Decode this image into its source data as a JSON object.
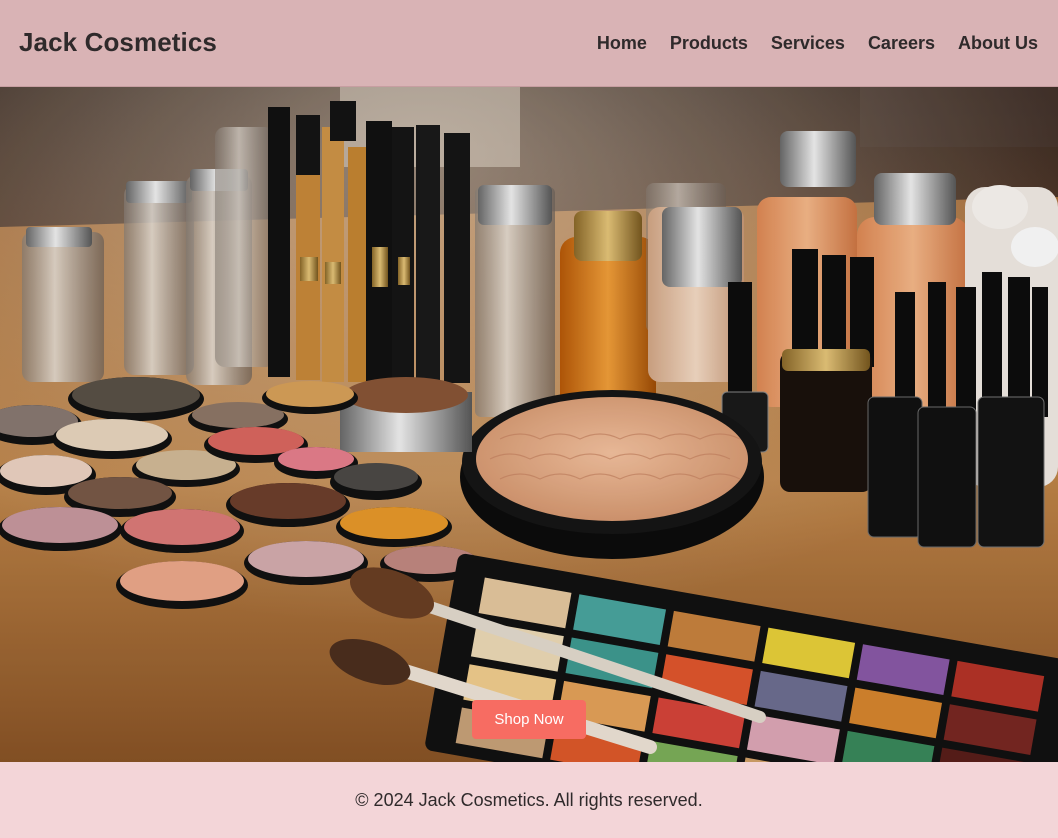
{
  "header": {
    "brand": "Jack Cosmetics",
    "nav": [
      {
        "label": "Home"
      },
      {
        "label": "Products"
      },
      {
        "label": "Services"
      },
      {
        "label": "Careers"
      },
      {
        "label": "About Us"
      }
    ]
  },
  "hero": {
    "cta_label": "Shop Now"
  },
  "footer": {
    "copyright": "© 2024 Jack Cosmetics. All rights reserved."
  },
  "colors": {
    "header_bg": "#d9b3b5",
    "footer_bg": "#f3d5d8",
    "cta_bg": "#f76c62",
    "text": "#2f2a2b"
  }
}
